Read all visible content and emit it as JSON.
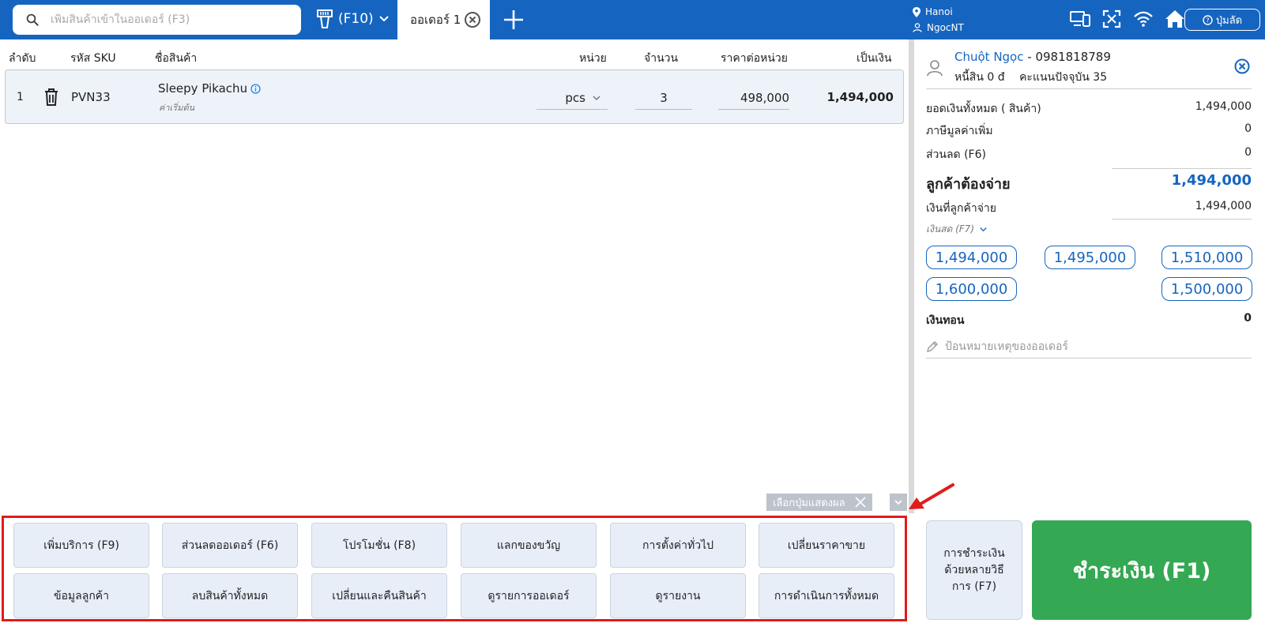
{
  "topbar": {
    "search_placeholder": "เพิ่มสินค้าเข้าในออเดอร์ (F3)",
    "scanner_label": "(F10)",
    "active_tab": "ออเดอร์ 1",
    "location": "Hanoi",
    "user": "NgocNT",
    "shortcut_label": "ปุ่มลัด"
  },
  "table": {
    "headers": {
      "idx": "ลำดับ",
      "sku": "รหัส SKU",
      "name": "ชื่อสินค้า",
      "unit": "หน่วย",
      "qty": "จำนวน",
      "price": "ราคาต่อหน่วย",
      "total": "เป็นเงิน"
    },
    "rows": [
      {
        "idx": "1",
        "sku": "PVN33",
        "name": "Sleepy Pikachu",
        "sub": "ค่าเริ่มต้น",
        "unit": "pcs",
        "qty": "3",
        "price": "498,000",
        "total": "1,494,000"
      }
    ]
  },
  "display_chip": "เลือกปุ่มแสดงผล",
  "function_buttons": [
    "เพิ่มบริการ (F9)",
    "ส่วนลดออเดอร์ (F6)",
    "โปรโมชั่น (F8)",
    "แลกของขวัญ",
    "การตั้งค่าทั่วไป",
    "เปลี่ยนราคาขาย",
    "ข้อมูลลูกค้า",
    "ลบสินค้าทั้งหมด",
    "เปลี่ยนและคืนสินค้า",
    "ดูรายการออเดอร์",
    "ดูรายงาน",
    "การดำเนินการทั้งหมด"
  ],
  "customer": {
    "name": "Chuột Ngọc",
    "phone": "- 0981818789",
    "debt": "หนี้สิน 0 đ",
    "points": "คะแนนปัจจุบัน 35"
  },
  "summary": {
    "subtotal_label": "ยอดเงินทั้งหมด ( สินค้า)",
    "subtotal": "1,494,000",
    "vat_label": "ภาษีมูลค่าเพิ่ม",
    "vat": "0",
    "discount_label": "ส่วนลด (F6)",
    "discount": "0",
    "to_pay_label": "ลูกค้าต้องจ่าย",
    "to_pay": "1,494,000",
    "paid_label": "เงินที่ลูกค้าจ่าย",
    "paid": "1,494,000",
    "cash_method": "เงินสด (F7)",
    "change_label": "เงินทอน",
    "change": "0",
    "note_placeholder": "ป้อนหมายเหตุของออเดอร์"
  },
  "quick_amounts": [
    "1,494,000",
    "1,495,000",
    "1,510,000",
    "1,600,000",
    "1,500,000"
  ],
  "multi_pay_label": "การชำระเงินด้วยหลายวิธีการ (F7)",
  "pay_label": "ชำระเงิน (F1)",
  "colors": {
    "primary": "#1565c0",
    "pay_green": "#34a853",
    "highlight_red": "#e11b1b"
  }
}
